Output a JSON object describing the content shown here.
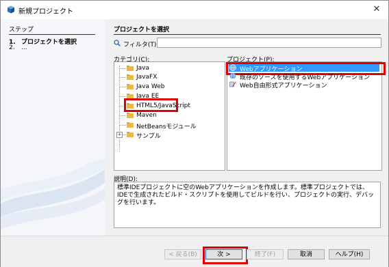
{
  "window": {
    "title": "新規プロジェクト",
    "close_glyph": "✕"
  },
  "steps": {
    "title": "ステップ",
    "items": [
      {
        "num": "1.",
        "label": "プロジェクトを選択"
      },
      {
        "num": "2.",
        "label": "..."
      }
    ]
  },
  "main": {
    "title": "プロジェクトを選択",
    "filter_label": "フィルタ(T):",
    "filter_value": "",
    "categories_label": "カテゴリ(C):",
    "projects_label": "プロジェクト(P):",
    "categories": [
      {
        "label": "Java",
        "expander": ""
      },
      {
        "label": "JavaFX",
        "expander": ""
      },
      {
        "label": "Java Web",
        "expander": ""
      },
      {
        "label": "Java EE",
        "expander": ""
      },
      {
        "label": "HTML5/JavaScript",
        "expander": ""
      },
      {
        "label": "Maven",
        "expander": ""
      },
      {
        "label": "NetBeansモジュール",
        "expander": ""
      },
      {
        "label": "サンプル",
        "expander": "+"
      }
    ],
    "projects": [
      {
        "label": "Webアプリケーション"
      },
      {
        "label": "既存のソースを使用するWebアプリケーション"
      },
      {
        "label": "Web自由形式アプリケーション"
      }
    ],
    "description_label": "説明(D):",
    "description_text": "標準IDEプロジェクトに空のWebアプリケーションを作成します。標準プロジェクトでは、IDEで生成されたビルド・スクリプトを使用してビルドを行い、プロジェクトの実行、デバッグを行います。"
  },
  "footer": {
    "back": "< 戻る(B)",
    "next": "次 >",
    "finish": "終了(F)",
    "cancel": "取消",
    "help": "ヘルプ(H)"
  },
  "colors": {
    "selection": "#3399ff",
    "highlight_box": "#e00000",
    "folder": "#e8b84a"
  }
}
